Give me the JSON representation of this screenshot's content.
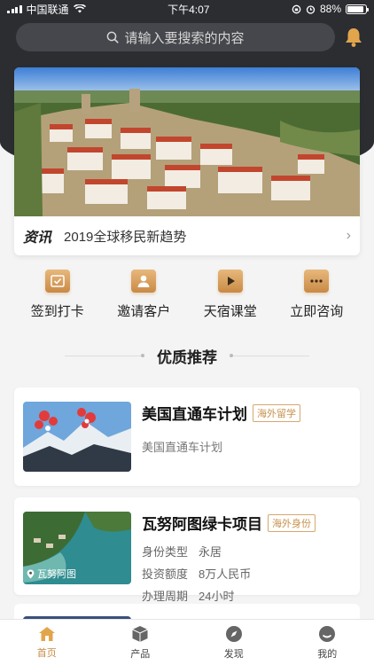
{
  "status_bar": {
    "carrier": "中国联通",
    "time": "下午4:07",
    "battery": "88%",
    "battery_level": 0.88
  },
  "search": {
    "placeholder": "请输入要搜索的内容"
  },
  "news": {
    "tag": "资讯",
    "title": "2019全球移民新趋势"
  },
  "quick_actions": [
    {
      "label": "签到打卡",
      "icon": "check-in-icon"
    },
    {
      "label": "邀请客户",
      "icon": "user-icon"
    },
    {
      "label": "天宿课堂",
      "icon": "play-icon"
    },
    {
      "label": "立即咨询",
      "icon": "chat-icon"
    }
  ],
  "section": {
    "title": "优质推荐"
  },
  "products": [
    {
      "name": "美国直通车计划",
      "badge": "海外留学",
      "subtitle": "美国直通车计划"
    },
    {
      "name": "瓦努阿图绿卡项目",
      "badge": "海外身份",
      "thumb_caption": "瓦努阿图",
      "specs": [
        {
          "label": "身份类型",
          "value": "永居"
        },
        {
          "label": "投资额度",
          "value": "8万人民币"
        },
        {
          "label": "办理周期",
          "value": "24小时"
        }
      ]
    }
  ],
  "tabs": [
    {
      "label": "首页",
      "icon": "home-icon",
      "active": true
    },
    {
      "label": "产品",
      "icon": "box-icon",
      "active": false
    },
    {
      "label": "发现",
      "icon": "compass-icon",
      "active": false
    },
    {
      "label": "我的",
      "icon": "profile-icon",
      "active": false
    }
  ],
  "colors": {
    "accent": "#c48b46",
    "header_bg": "#2b2d31"
  }
}
